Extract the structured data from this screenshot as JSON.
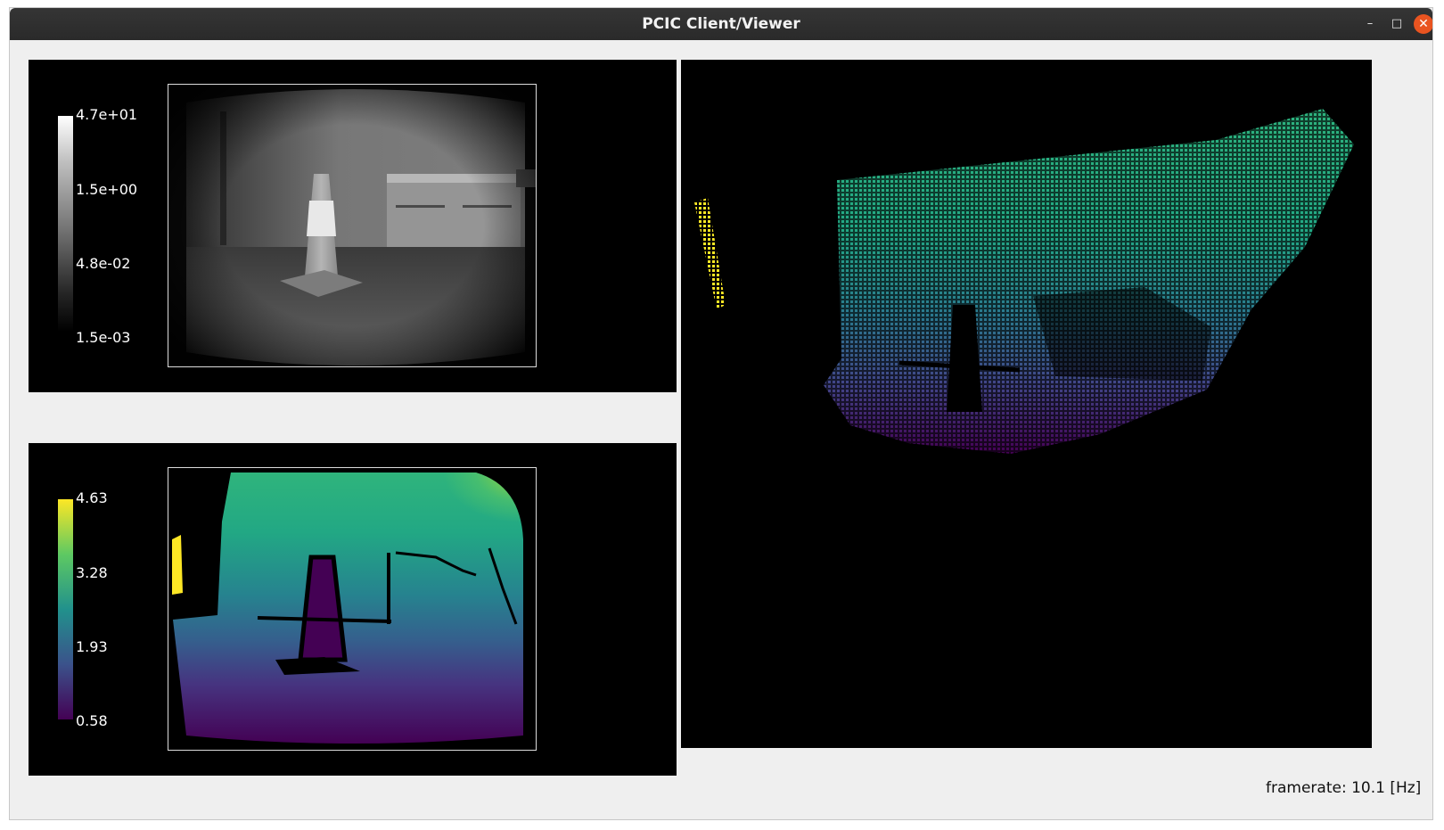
{
  "window": {
    "title": "PCIC Client/Viewer",
    "controls": {
      "minimize": "–",
      "maximize": "□",
      "close": "✕"
    }
  },
  "amplitude_view": {
    "colorbar_labels": [
      "4.7e+01",
      "1.5e+00",
      "4.8e-02",
      "1.5e-03"
    ],
    "colormap": "gray"
  },
  "distance_view": {
    "colorbar_labels": [
      "4.63",
      "3.28",
      "1.93",
      "0.58"
    ],
    "colormap": "viridis"
  },
  "point_cloud_view": {
    "colormap": "viridis"
  },
  "status": {
    "framerate": "framerate: 10.1 [Hz]"
  }
}
